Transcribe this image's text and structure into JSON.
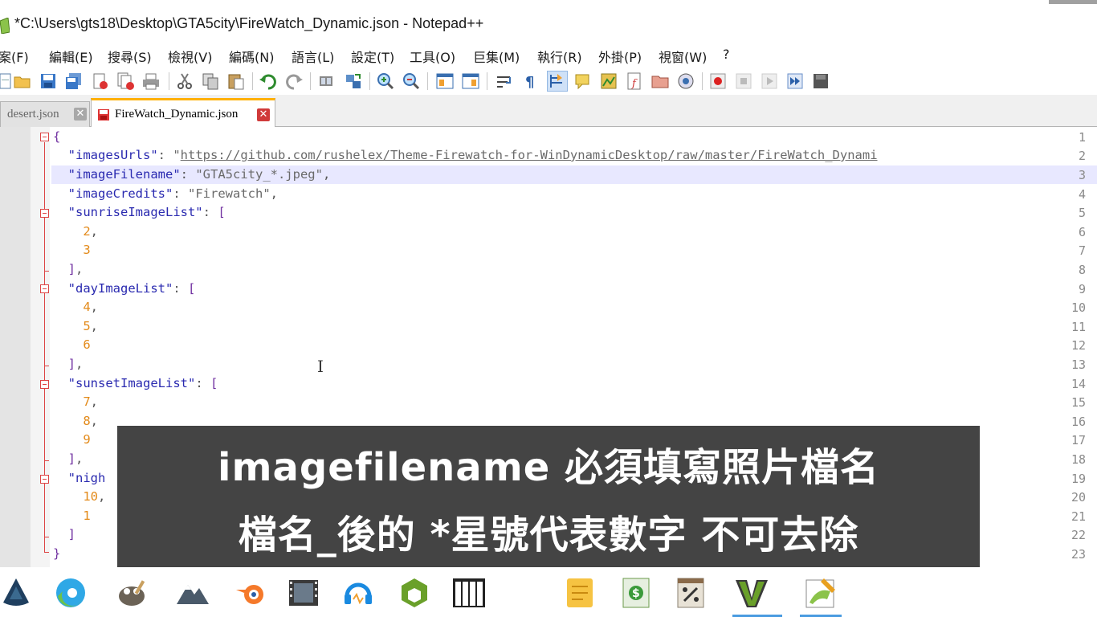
{
  "window": {
    "title": "*C:\\Users\\gts18\\Desktop\\GTA5city\\FireWatch_Dynamic.json - Notepad++"
  },
  "menu": [
    {
      "label": "案(F)",
      "key": "file"
    },
    {
      "label": "編輯(E)",
      "key": "edit"
    },
    {
      "label": "搜尋(S)",
      "key": "search"
    },
    {
      "label": "檢視(V)",
      "key": "view"
    },
    {
      "label": "編碼(N)",
      "key": "encoding"
    },
    {
      "label": "語言(L)",
      "key": "language"
    },
    {
      "label": "設定(T)",
      "key": "settings"
    },
    {
      "label": "工具(O)",
      "key": "tools"
    },
    {
      "label": "巨集(M)",
      "key": "macro"
    },
    {
      "label": "執行(R)",
      "key": "run"
    },
    {
      "label": "外掛(P)",
      "key": "plugins"
    },
    {
      "label": "視窗(W)",
      "key": "window"
    },
    {
      "label": "?",
      "key": "help"
    }
  ],
  "toolbar_icons": [
    "new-file-icon",
    "open-file-icon",
    "save-icon",
    "save-all-icon",
    "close-icon",
    "close-all-icon",
    "print-icon",
    "cut-icon",
    "copy-icon",
    "paste-icon",
    "undo-icon",
    "redo-icon",
    "find-icon",
    "replace-icon",
    "zoom-in-icon",
    "zoom-out-icon",
    "sync-vertical-icon",
    "sync-horizontal-icon",
    "word-wrap-icon",
    "show-all-chars-icon",
    "indent-guide-icon",
    "user-language-icon",
    "doc-map-icon",
    "function-list-icon",
    "folder-workspace-icon",
    "monitor-icon",
    "record-macro-icon",
    "stop-macro-icon",
    "play-macro-icon",
    "run-macro-multiple-icon",
    "save-macro-icon"
  ],
  "tabs": [
    {
      "label": "desert.json",
      "active": false
    },
    {
      "label": "FireWatch_Dynamic.json",
      "active": true
    }
  ],
  "editor": {
    "line_numbers": [
      "1",
      "2",
      "3",
      "4",
      "5",
      "6",
      "7",
      "8",
      "9",
      "10",
      "11",
      "12",
      "13",
      "14",
      "15",
      "16",
      "17",
      "18",
      "19",
      "20",
      "21",
      "22",
      "23"
    ],
    "current_line": 3,
    "tokens": {
      "l1_open": "{",
      "l2_key": "\"imagesUrls\"",
      "l2_sep": ": ",
      "l2_q": "\"",
      "l2_url": "https://github.com/rushelex/Theme-Firewatch-for-WinDynamicDesktop/raw/master/FireWatch_Dynami",
      "l3_key": "\"imageFilename\"",
      "l3_sep": ": ",
      "l3_val": "\"GTA5city_*.jpeg\"",
      "l3_comma": ",",
      "l4_key": "\"imageCredits\"",
      "l4_sep": ": ",
      "l4_val": "\"Firewatch\"",
      "l4_comma": ",",
      "l5_key": "\"sunriseImageList\"",
      "l5_sep": ": ",
      "l5_br": "[",
      "l6_num": "2",
      "l6_comma": ",",
      "l7_num": "3",
      "l8_br": "]",
      "l8_comma": ",",
      "l9_key": "\"dayImageList\"",
      "l9_sep": ": ",
      "l9_br": "[",
      "l10_num": "4",
      "l10_comma": ",",
      "l11_num": "5",
      "l11_comma": ",",
      "l12_num": "6",
      "l13_br": "]",
      "l13_comma": ",",
      "l14_key": "\"sunsetImageList\"",
      "l14_sep": ": ",
      "l14_br": "[",
      "l15_num": "7",
      "l15_comma": ",",
      "l16_num": "8",
      "l16_comma": ",",
      "l17_num": "9",
      "l18_br": "]",
      "l18_comma": ",",
      "l19_key": "\"nigh",
      "l20_num": "10",
      "l20_comma": ",",
      "l21_num": "1",
      "l22_br": "]",
      "l23_close": "}"
    }
  },
  "subtitle": {
    "line1": "imagefilename 必須填寫照片檔名",
    "line2": "檔名_後的 *星號代表數字 不可去除"
  },
  "taskbar_icons": [
    "inkscape-icon",
    "edge-icon",
    "gimp-icon",
    "mountain-app-icon",
    "blender-icon",
    "video-editor-icon",
    "audio-icon",
    "app-cube-icon",
    "piano-icon",
    "notes-icon",
    "money-app-icon",
    "calculator-icon",
    "gta-v-icon",
    "notepadpp-icon"
  ],
  "colors": {
    "key": "#2a2ab0",
    "string": "#6a6a6a",
    "number": "#e38a1a",
    "bracket": "#7030a0",
    "caret_line": "#e8e8ff",
    "active_tab_accent": "#ffb000",
    "fold_marker": "#dd4444"
  }
}
